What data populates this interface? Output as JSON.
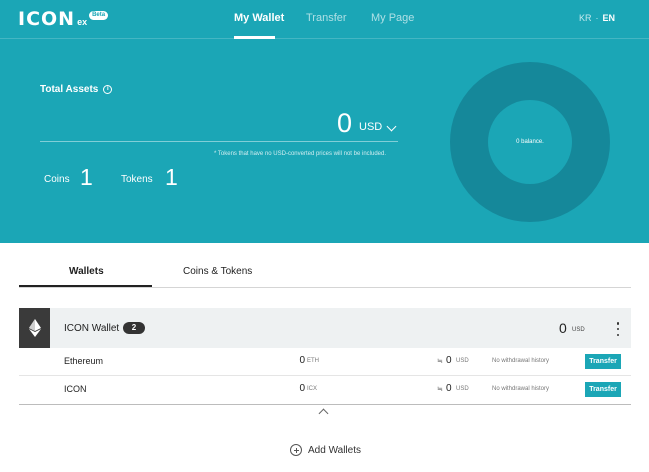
{
  "header": {
    "logo_text": "ICON",
    "logo_sub": "ex",
    "logo_badge": "Beta",
    "nav": [
      {
        "label": "My Wallet",
        "active": true
      },
      {
        "label": "Transfer",
        "active": false
      },
      {
        "label": "My Page",
        "active": false
      }
    ],
    "lang": {
      "kr": "KR",
      "separator": "·",
      "en": "EN",
      "active": "EN"
    }
  },
  "summary": {
    "total_assets_label": "Total Assets",
    "total_value": "0",
    "currency": "USD",
    "note": "* Tokens that have no USD-converted prices will not be included.",
    "coins_label": "Coins",
    "coins_count": "1",
    "tokens_label": "Tokens",
    "tokens_count": "1",
    "chart_label": "0 balance."
  },
  "tabs": [
    {
      "label": "Wallets",
      "active": true
    },
    {
      "label": "Coins & Tokens",
      "active": false
    }
  ],
  "wallet": {
    "name": "ICON Wallet",
    "count": "2",
    "total": "0",
    "total_unit": "USD",
    "rows": [
      {
        "name": "Ethereum",
        "balance": "0",
        "unit": "ETH",
        "approx": "≒",
        "usd": "0",
        "usd_unit": "USD",
        "history": "No withdrawal history",
        "action": "Transfer"
      },
      {
        "name": "ICON",
        "balance": "0",
        "unit": "ICX",
        "approx": "≒",
        "usd": "0",
        "usd_unit": "USD",
        "history": "No withdrawal history",
        "action": "Transfer"
      }
    ]
  },
  "add_wallets_label": "Add Wallets",
  "colors": {
    "primary": "#1ba6b6",
    "donut_ring": "#15889a"
  }
}
